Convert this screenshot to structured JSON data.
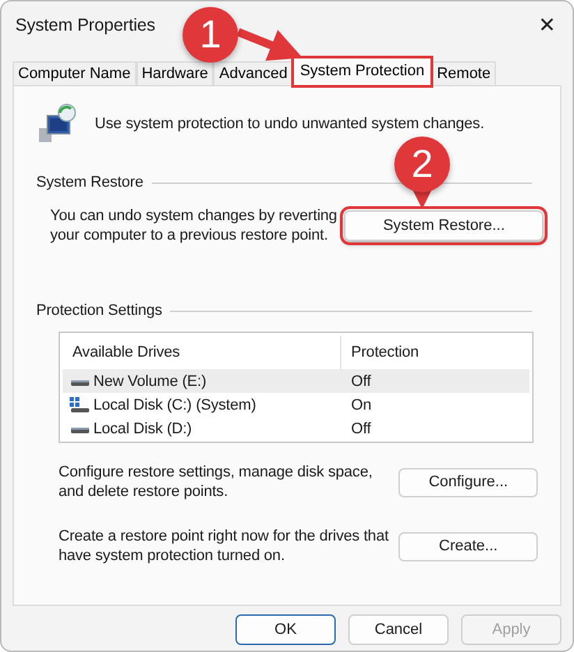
{
  "window": {
    "title": "System Properties",
    "close": "✕"
  },
  "tabs": [
    {
      "label": "Computer Name",
      "selected": false,
      "highlighted": false
    },
    {
      "label": "Hardware",
      "selected": false,
      "highlighted": false
    },
    {
      "label": "Advanced",
      "selected": false,
      "highlighted": false
    },
    {
      "label": "System Protection",
      "selected": true,
      "highlighted": true
    },
    {
      "label": "Remote",
      "selected": false,
      "highlighted": false
    }
  ],
  "intro": "Use system protection to undo unwanted system changes.",
  "system_restore": {
    "heading": "System Restore",
    "description": "You can undo system changes by reverting your computer to a previous restore point.",
    "button": {
      "label": "System Restore...",
      "highlighted": true
    }
  },
  "protection_settings": {
    "heading": "Protection Settings",
    "columns": [
      "Available Drives",
      "Protection"
    ],
    "rows": [
      {
        "drive": "New Volume (E:)",
        "protection": "Off",
        "kind": "volume",
        "selected": true
      },
      {
        "drive": "Local Disk (C:) (System)",
        "protection": "On",
        "kind": "system",
        "selected": false
      },
      {
        "drive": "Local Disk (D:)",
        "protection": "Off",
        "kind": "volume",
        "selected": false
      }
    ],
    "actions": [
      {
        "text": "Configure restore settings, manage disk space, and delete restore points.",
        "button": "Configure..."
      },
      {
        "text": "Create a restore point right now for the drives that have system protection turned on.",
        "button": "Create..."
      }
    ]
  },
  "buttons": [
    {
      "label": "OK",
      "kind": "default",
      "disabled": false
    },
    {
      "label": "Cancel",
      "kind": "normal",
      "disabled": false
    },
    {
      "label": "Apply",
      "kind": "normal",
      "disabled": true
    }
  ],
  "annotations": [
    {
      "number": "1"
    },
    {
      "number": "2"
    }
  ]
}
